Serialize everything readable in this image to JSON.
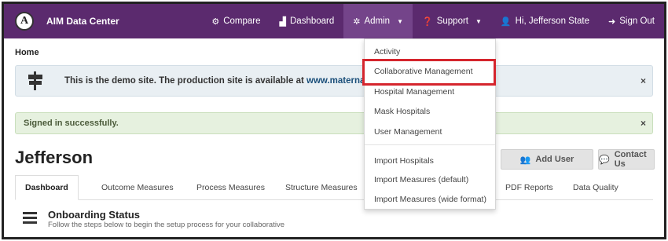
{
  "navbar": {
    "logo_letter": "A",
    "brand": "AIM Data Center",
    "compare": "Compare",
    "dashboard": "Dashboard",
    "admin": "Admin",
    "support": "Support",
    "user": "Hi, Jefferson State",
    "signout": "Sign Out",
    "background_color": "#5b2a6e",
    "active_color": "#74448a"
  },
  "breadcrumb": "Home",
  "alerts": {
    "info_text": "This is the demo site. The production site is available at ",
    "info_link": "www.materna",
    "success_text": "Signed in successfully.",
    "close": "×"
  },
  "page": {
    "title": "Jefferson",
    "add_user": "Add User",
    "contact_us": "Contact Us"
  },
  "tabs": [
    "Dashboard",
    "Outcome Measures",
    "Process Measures",
    "Structure Measures",
    "PDF Reports",
    "Data Quality"
  ],
  "onboarding": {
    "title": "Onboarding Status",
    "subtitle": "Follow the steps below to begin the setup process for your collaborative"
  },
  "admin_menu": [
    "Activity",
    "Collaborative Management",
    "Hospital Management",
    "Mask Hospitals",
    "User Management",
    "Import Hospitals",
    "Import Measures (default)",
    "Import Measures (wide format)"
  ],
  "highlight_color": "#d5252d"
}
